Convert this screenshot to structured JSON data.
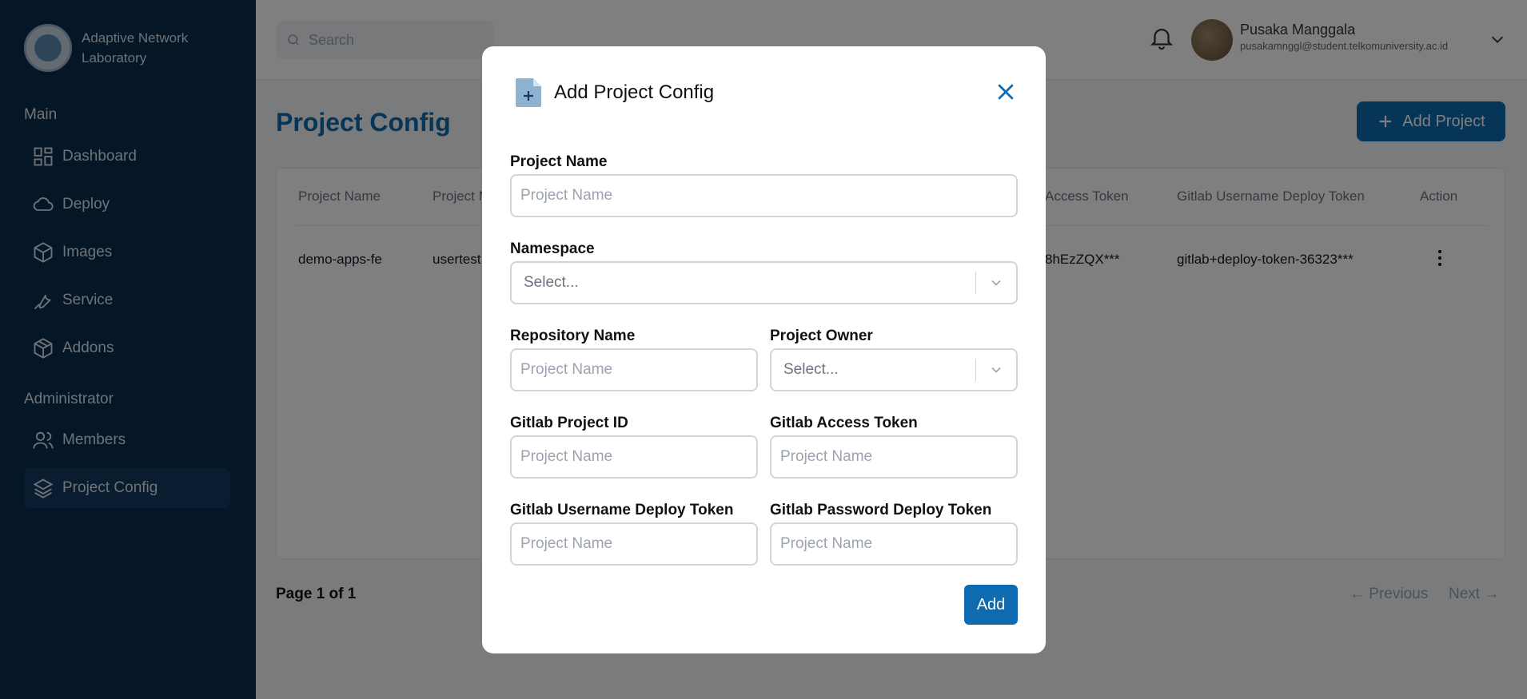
{
  "sidebar": {
    "brand": "Adaptive Network Laboratory",
    "sections": {
      "main": "Main",
      "admin": "Administrator"
    },
    "items": [
      {
        "label": "Dashboard",
        "icon": "dashboard-icon"
      },
      {
        "label": "Deploy",
        "icon": "cloud-icon"
      },
      {
        "label": "Images",
        "icon": "box-icon"
      },
      {
        "label": "Service",
        "icon": "wrench-icon"
      },
      {
        "label": "Addons",
        "icon": "package-icon"
      },
      {
        "label": "Members",
        "icon": "users-icon"
      },
      {
        "label": "Project Config",
        "icon": "layers-icon",
        "active": true
      }
    ]
  },
  "topbar": {
    "search_placeholder": "Search",
    "user_name": "Pusaka Manggala",
    "user_email": "pusakamnggl@student.telkomuniversity.ac.id"
  },
  "main": {
    "title": "Project Config",
    "add_button": "Add Project",
    "table": {
      "headers": [
        "Project Name",
        "Project N",
        "Access Token",
        "Gitlab Username Deploy Token",
        "Action"
      ],
      "row": [
        "demo-apps-fe",
        "usertest",
        "8hEzZQX***",
        "gitlab+deploy-token-36323***"
      ]
    },
    "pagination": {
      "info": "Page 1 of 1",
      "previous": "Previous",
      "next": "Next"
    }
  },
  "modal": {
    "title": "Add Project Config",
    "fields": {
      "project_name": {
        "label": "Project Name",
        "placeholder": "Project Name"
      },
      "namespace": {
        "label": "Namespace",
        "placeholder": "Select..."
      },
      "repository_name": {
        "label": "Repository Name",
        "placeholder": "Project Name"
      },
      "project_owner": {
        "label": "Project Owner",
        "placeholder": "Select..."
      },
      "gitlab_project_id": {
        "label": "Gitlab Project ID",
        "placeholder": "Project Name"
      },
      "gitlab_access_token": {
        "label": "Gitlab Access Token",
        "placeholder": "Project Name"
      },
      "gitlab_username_deploy_token": {
        "label": "Gitlab Username Deploy Token",
        "placeholder": "Project Name"
      },
      "gitlab_password_deploy_token": {
        "label": "Gitlab Password Deploy Token",
        "placeholder": "Project Name"
      }
    },
    "submit_label": "Add"
  },
  "colors": {
    "primary": "#0e6bb0",
    "sidebar": "#0b2d4d",
    "overlay": "rgba(0,0,0,0.5)"
  }
}
